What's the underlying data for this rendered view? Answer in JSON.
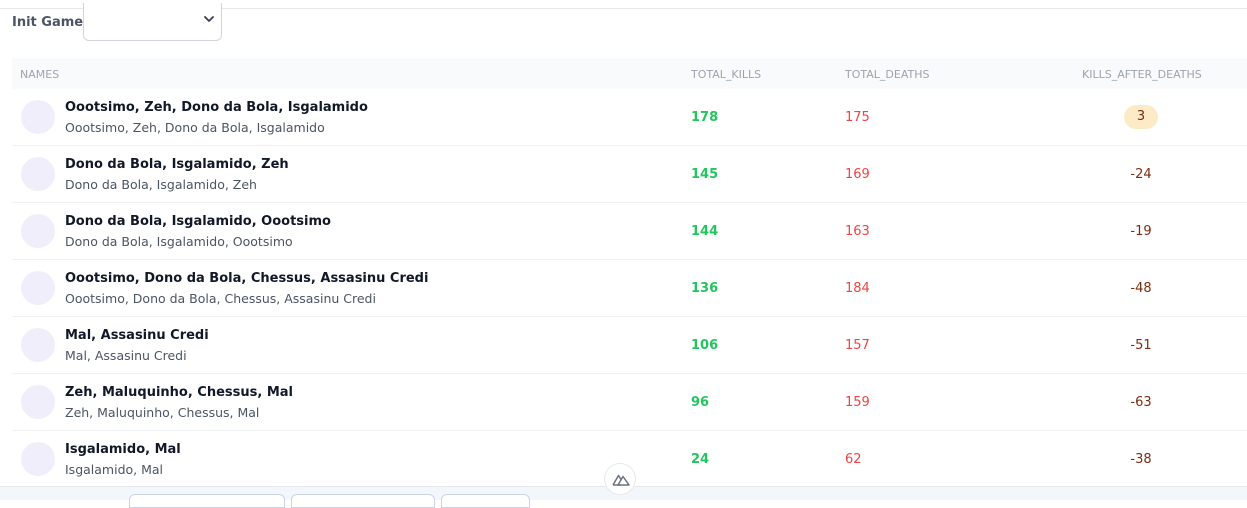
{
  "filter": {
    "label": "Init Game",
    "selected": ""
  },
  "table": {
    "headers": {
      "names": "NAMES",
      "total_kills": "TOTAL_KILLS",
      "total_deaths": "TOTAL_DEATHS",
      "kills_after_deaths": "KILLS_AFTER_DEATHS"
    },
    "rows": [
      {
        "title": "Oootsimo, Zeh, Dono da Bola, Isgalamido",
        "subtitle": "Oootsimo, Zeh, Dono da Bola, Isgalamido",
        "kills": "178",
        "deaths": "175",
        "kad": "3"
      },
      {
        "title": "Dono da Bola, Isgalamido, Zeh",
        "subtitle": "Dono da Bola, Isgalamido, Zeh",
        "kills": "145",
        "deaths": "169",
        "kad": "-24"
      },
      {
        "title": "Dono da Bola, Isgalamido, Oootsimo",
        "subtitle": "Dono da Bola, Isgalamido, Oootsimo",
        "kills": "144",
        "deaths": "163",
        "kad": "-19"
      },
      {
        "title": "Oootsimo, Dono da Bola, Chessus, Assasinu Credi",
        "subtitle": "Oootsimo, Dono da Bola, Chessus, Assasinu Credi",
        "kills": "136",
        "deaths": "184",
        "kad": "-48"
      },
      {
        "title": "Mal, Assasinu Credi",
        "subtitle": "Mal, Assasinu Credi",
        "kills": "106",
        "deaths": "157",
        "kad": "-51"
      },
      {
        "title": "Zeh, Maluquinho, Chessus, Mal",
        "subtitle": "Zeh, Maluquinho, Chessus, Mal",
        "kills": "96",
        "deaths": "159",
        "kad": "-63"
      },
      {
        "title": "Isgalamido, Mal",
        "subtitle": "Isgalamido, Mal",
        "kills": "24",
        "deaths": "62",
        "kad": "-38"
      }
    ]
  },
  "colors": {
    "kills": "#22c55e",
    "deaths": "#ef4444",
    "kad": "#7c2d12",
    "badge_bg": "#fdebc8"
  },
  "icons": {
    "select": "chevron-down-icon",
    "devtools": "nuxt-logo-icon"
  }
}
